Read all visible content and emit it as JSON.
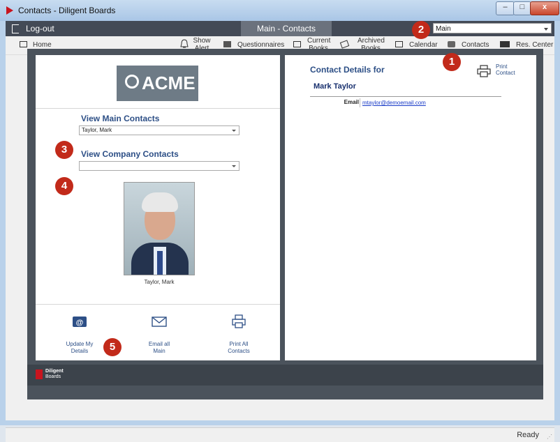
{
  "window": {
    "title": "Contacts - Diligent Boards",
    "minimize": "–",
    "maximize": "□",
    "close": "x"
  },
  "navbar": {
    "logout": "Log-out",
    "active_tab": "Main - Contacts",
    "book_select": "Main"
  },
  "toolbar": {
    "home": "Home",
    "show_alert": [
      "Show",
      "Alert"
    ],
    "questionnaires": "Questionnaires",
    "current_books": [
      "Current",
      "Books"
    ],
    "archived_books": [
      "Archived",
      "Books"
    ],
    "calendar": "Calendar",
    "contacts": "Contacts",
    "res_center": "Res. Center"
  },
  "left_panel": {
    "logo_text": "ACME",
    "view_main_contacts": "View Main Contacts",
    "main_contacts_selected": "Taylor, Mark",
    "view_company_contacts": "View Company Contacts",
    "company_contacts_selected": "",
    "photo_caption": "Taylor, Mark",
    "actions": [
      {
        "label1": "Update My",
        "label2": "Details"
      },
      {
        "label1": "Email all",
        "label2": "Main"
      },
      {
        "label1": "Print All",
        "label2": "Contacts"
      }
    ]
  },
  "right_panel": {
    "header": "Contact Details for",
    "name": "Mark Taylor",
    "email_label": "Email",
    "email_value": "mtaylor@demoemail.com",
    "print_contact": [
      "Print",
      "Contact"
    ]
  },
  "footer": {
    "brand1": "Diligent",
    "brand2": "Boards"
  },
  "badges": [
    "1",
    "2",
    "3",
    "4",
    "5"
  ],
  "status": "Ready",
  "colors": {
    "accent_blue": "#2d4f86",
    "badge_red": "#c22a1a",
    "navbar": "#434a56",
    "stage": "#4b535c"
  }
}
